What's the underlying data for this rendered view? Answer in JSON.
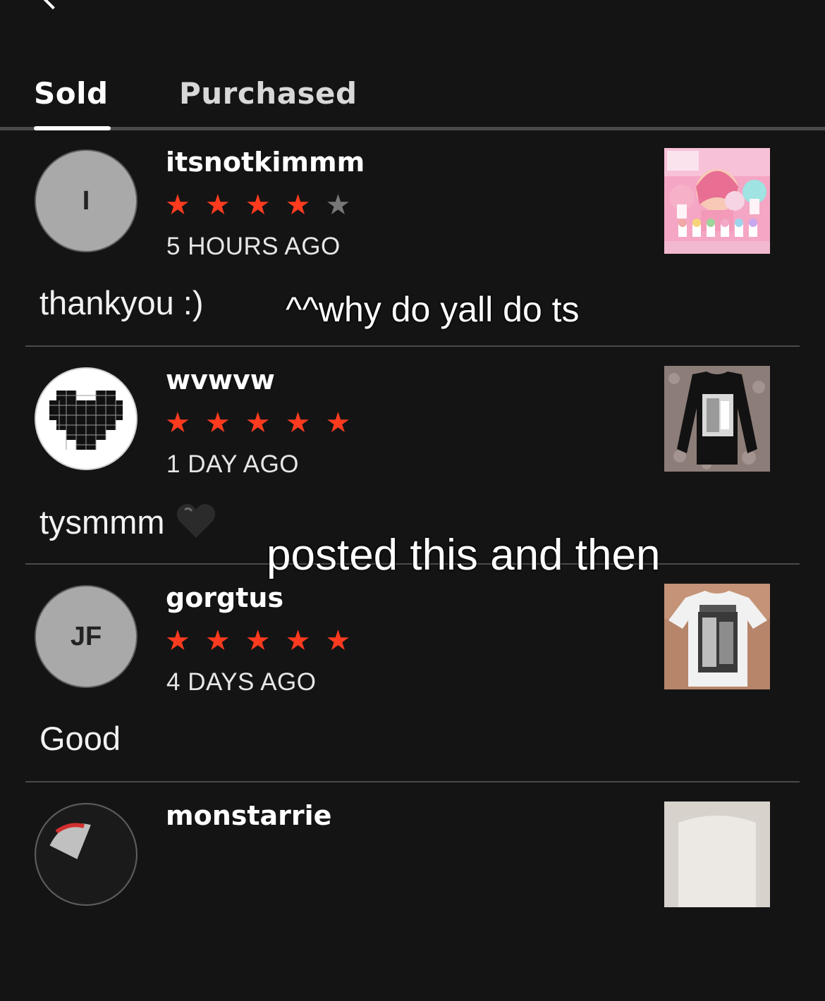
{
  "tabs": [
    {
      "label": "Sold",
      "active": true
    },
    {
      "label": "Purchased",
      "active": false
    }
  ],
  "reviews": [
    {
      "username": "itsnotkimmm",
      "avatar_initials": "I",
      "rating": 4,
      "time": "5 HOURS AGO",
      "comment": "thankyou :)",
      "thumb": "pink-collage-product-photo"
    },
    {
      "username": "wvwvw",
      "avatar_icon": "studded-heart-icon",
      "rating": 5,
      "time": "1 DAY AGO",
      "comment": "tysmmm",
      "comment_emoji": "black-heart-icon",
      "thumb": "black-long-sleeve-shirt-photo"
    },
    {
      "username": "gorgtus",
      "avatar_initials": "JF",
      "rating": 5,
      "time": "4 DAYS AGO",
      "comment": "Good",
      "thumb": "white-graphic-tee-photo"
    },
    {
      "username": "monstarrie",
      "avatar_icon": "profile-photo",
      "thumb": "product-photo"
    }
  ],
  "overlays": {
    "caption_1": "^^why do yall do ts",
    "caption_2": "posted this and then"
  },
  "colors": {
    "background": "#141414",
    "star_filled": "#ff3b1f",
    "star_empty": "#777777",
    "avatar_gray": "#a9a9a9"
  }
}
